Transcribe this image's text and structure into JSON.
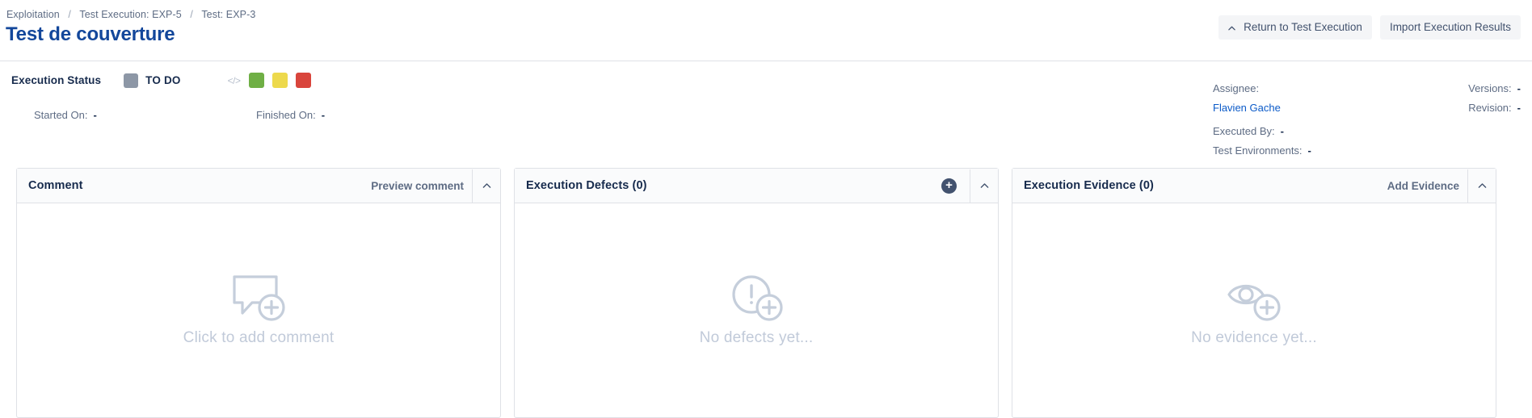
{
  "breadcrumb": {
    "items": [
      "Exploitation",
      "Test Execution: EXP-5",
      "Test: EXP-3"
    ],
    "separator": "/"
  },
  "page_title": "Test de couverture",
  "header_actions": {
    "return_button": "Return to Test Execution",
    "return_icon": "chevron-up-icon",
    "import_button": "Import Execution Results"
  },
  "execution_status": {
    "label": "Execution Status",
    "value": "TO DO",
    "swatch_color": "#8D97A6",
    "code_icon": "</>",
    "quick_statuses": [
      {
        "name": "pass",
        "color": "#6FAF45"
      },
      {
        "name": "aborted",
        "color": "#EDD94C"
      },
      {
        "name": "fail",
        "color": "#D9453C"
      }
    ]
  },
  "timing": {
    "started_label": "Started On:",
    "started_value": "-",
    "finished_label": "Finished On:",
    "finished_value": "-"
  },
  "meta": {
    "assignee_label": "Assignee:",
    "assignee_name": "Flavien Gache",
    "executed_by_label": "Executed By:",
    "executed_by_value": "-",
    "test_environments_label": "Test Environments:",
    "test_environments_value": "-",
    "versions_label": "Versions:",
    "versions_value": "-",
    "revision_label": "Revision:",
    "revision_value": "-"
  },
  "panels": {
    "comment": {
      "title": "Comment",
      "action": "Preview comment",
      "empty_text": "Click to add comment",
      "empty_icon": "comment-add-icon"
    },
    "defects": {
      "title": "Execution Defects (0)",
      "add_icon": "+",
      "empty_text": "No defects yet...",
      "empty_icon": "defect-add-icon"
    },
    "evidence": {
      "title": "Execution Evidence (0)",
      "action": "Add Evidence",
      "empty_text": "No evidence yet...",
      "empty_icon": "evidence-add-icon"
    }
  }
}
